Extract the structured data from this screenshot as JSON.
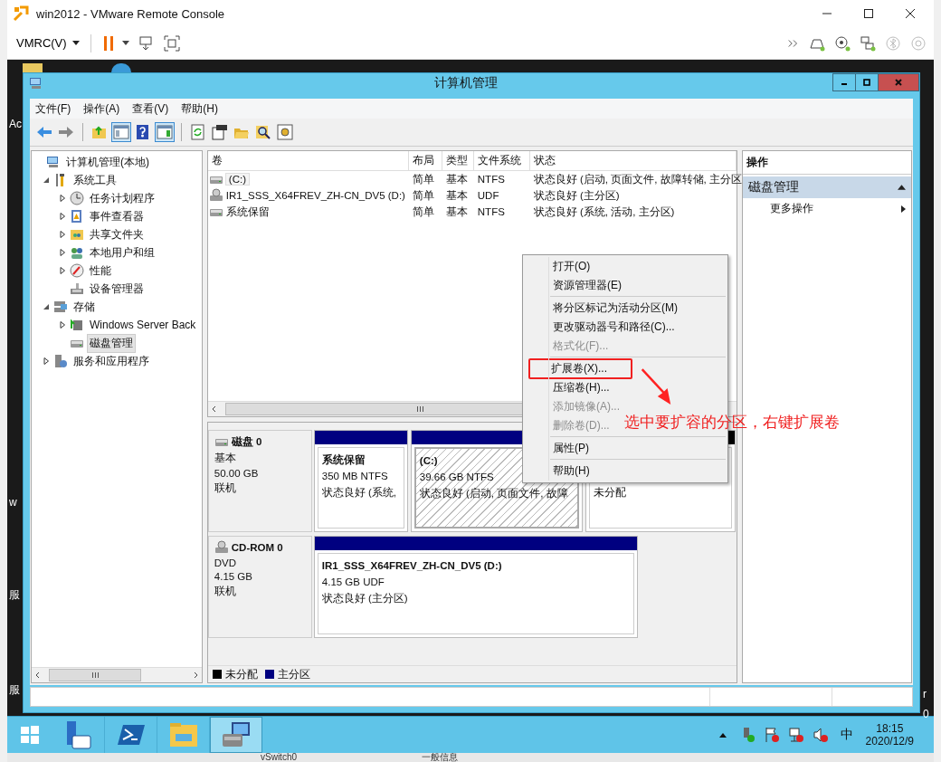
{
  "vmrc": {
    "title": "win2012 - VMware Remote Console",
    "menu": "VMRC(V)"
  },
  "desktop_labels": [
    {
      "text": "Ac"
    },
    {
      "text": "w"
    },
    {
      "text": "服"
    },
    {
      "text": "服"
    },
    {
      "text": "r"
    },
    {
      "text": "0"
    }
  ],
  "window": {
    "title": "计算机管理",
    "menu": [
      "文件(F)",
      "操作(A)",
      "查看(V)",
      "帮助(H)"
    ]
  },
  "tree": [
    {
      "label": "计算机管理(本地)",
      "kind": "computer",
      "selected": false,
      "children": [
        {
          "label": "系统工具",
          "kind": "tools",
          "expanded": true,
          "selected": false,
          "children": [
            {
              "label": "任务计划程序",
              "kind": "clock",
              "expanded": false,
              "selected": false
            },
            {
              "label": "事件查看器",
              "kind": "log",
              "expanded": false,
              "selected": false
            },
            {
              "label": "共享文件夹",
              "kind": "share",
              "expanded": false,
              "selected": false
            },
            {
              "label": "本地用户和组",
              "kind": "users",
              "expanded": false,
              "selected": false
            },
            {
              "label": "性能",
              "kind": "gauge",
              "expanded": false,
              "selected": false
            },
            {
              "label": "设备管理器",
              "kind": "device",
              "selected": false
            }
          ]
        },
        {
          "label": "存储",
          "kind": "storage",
          "expanded": true,
          "selected": false,
          "children": [
            {
              "label": "Windows Server Back",
              "kind": "backup",
              "expanded": false,
              "selected": false
            },
            {
              "label": "磁盘管理",
              "kind": "disk",
              "selected": true
            }
          ]
        },
        {
          "label": "服务和应用程序",
          "kind": "services",
          "expanded": false,
          "selected": false
        }
      ]
    }
  ],
  "table": {
    "columns": [
      "卷",
      "布局",
      "类型",
      "文件系统",
      "状态"
    ],
    "rows": [
      {
        "kind": "disk",
        "selected": true,
        "cells": [
          "(C:)",
          "简单",
          "基本",
          "NTFS",
          "状态良好 (启动, 页面文件, 故障转储, 主分区"
        ]
      },
      {
        "kind": "cdrom",
        "selected": false,
        "cells": [
          "IR1_SSS_X64FREV_ZH-CN_DV5 (D:)",
          "简单",
          "基本",
          "UDF",
          "状态良好 (主分区)"
        ]
      },
      {
        "kind": "disk",
        "selected": false,
        "cells": [
          "系统保留",
          "简单",
          "基本",
          "NTFS",
          "状态良好 (系统, 活动, 主分区)"
        ]
      }
    ]
  },
  "disks": [
    {
      "kind": "disk",
      "name": "磁盘 0",
      "type": "基本",
      "size": "50.00 GB",
      "status": "联机",
      "partitions": [
        {
          "kind": "primary",
          "selected": false,
          "name": "系统保留",
          "size": "350 MB NTFS",
          "status": "状态良好 (系统,"
        },
        {
          "kind": "primary",
          "selected": true,
          "name": "(C:)",
          "size": "39.66 GB NTFS",
          "status": "状态良好 (启动, 页面文件, 故障"
        },
        {
          "kind": "unallocated",
          "selected": false,
          "status": "未分配"
        }
      ]
    },
    {
      "kind": "cdrom",
      "name": "CD-ROM 0",
      "type": "DVD",
      "size": "4.15 GB",
      "status": "联机",
      "partitions": [
        {
          "kind": "primary",
          "selected": false,
          "name": "IR1_SSS_X64FREV_ZH-CN_DV5   (D:)",
          "size": "4.15 GB UDF",
          "status": "状态良好 (主分区)"
        }
      ]
    }
  ],
  "legend": [
    {
      "label": "未分配",
      "color": "#000000"
    },
    {
      "label": "主分区",
      "color": "#000080"
    }
  ],
  "actions": {
    "header": "操作",
    "section": "磁盘管理",
    "items": [
      "更多操作"
    ]
  },
  "context_menu": [
    {
      "items": [
        {
          "label": "打开(O)",
          "disabled": false,
          "highlighted": false
        },
        {
          "label": "资源管理器(E)",
          "disabled": false,
          "highlighted": false
        }
      ]
    },
    {
      "items": [
        {
          "label": "将分区标记为活动分区(M)",
          "disabled": false,
          "highlighted": false
        },
        {
          "label": "更改驱动器号和路径(C)...",
          "disabled": false,
          "highlighted": false
        },
        {
          "label": "格式化(F)...",
          "disabled": true,
          "highlighted": false
        }
      ]
    },
    {
      "items": [
        {
          "label": "扩展卷(X)...",
          "disabled": false,
          "highlighted": true
        },
        {
          "label": "压缩卷(H)...",
          "disabled": false,
          "highlighted": false
        },
        {
          "label": "添加镜像(A)...",
          "disabled": true,
          "highlighted": false
        },
        {
          "label": "删除卷(D)...",
          "disabled": true,
          "highlighted": false
        }
      ]
    },
    {
      "items": [
        {
          "label": "属性(P)",
          "disabled": false,
          "highlighted": false
        }
      ]
    },
    {
      "items": [
        {
          "label": "帮助(H)",
          "disabled": false,
          "highlighted": false
        }
      ]
    }
  ],
  "annotation": "选中要扩容的分区，右键扩展卷",
  "taskbar": {
    "apps": [
      {
        "kind": "server-manager",
        "selected": false
      },
      {
        "kind": "powershell",
        "selected": false
      },
      {
        "kind": "explorer",
        "selected": false
      },
      {
        "kind": "computer-management",
        "selected": true
      }
    ],
    "ime": "中",
    "time": "18:15",
    "date": "2020/12/9"
  },
  "background_window": [
    "vSwitch0",
    "一般信息"
  ]
}
